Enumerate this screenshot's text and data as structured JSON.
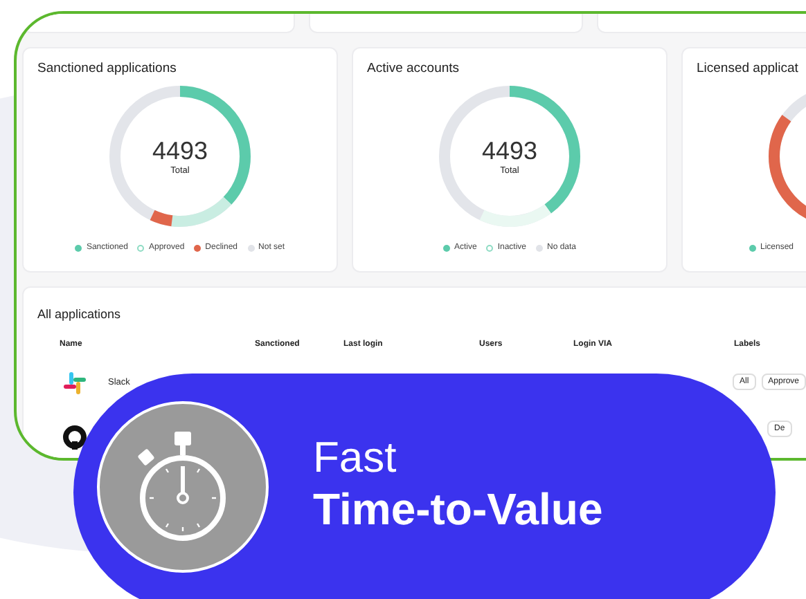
{
  "cards": [
    {
      "title": "Sanctioned applications",
      "total": "4493",
      "total_label": "Total",
      "legend": [
        {
          "label": "Sanctioned",
          "kind": "dot",
          "color": "#5ccbab"
        },
        {
          "label": "Approved",
          "kind": "ring",
          "color": "#8fdcc4"
        },
        {
          "label": "Declined",
          "kind": "dot",
          "color": "#e0664b"
        },
        {
          "label": "Not set",
          "kind": "dot",
          "color": "#e1e3e8"
        }
      ]
    },
    {
      "title": "Active accounts",
      "total": "4493",
      "total_label": "Total",
      "legend": [
        {
          "label": "Active",
          "kind": "dot",
          "color": "#5ccbab"
        },
        {
          "label": "Inactive",
          "kind": "ring",
          "color": "#8fdcc4"
        },
        {
          "label": "No data",
          "kind": "dot",
          "color": "#e1e3e8"
        }
      ]
    },
    {
      "title": "Licensed applicat",
      "legend": [
        {
          "label": "Licensed",
          "kind": "dot",
          "color": "#5ccbab"
        }
      ]
    }
  ],
  "table": {
    "title": "All applications",
    "columns": [
      "Name",
      "Sanctioned",
      "Last login",
      "Users",
      "Login VIA",
      "Labels"
    ],
    "rows": [
      {
        "name": "Slack",
        "labels": [
          "All",
          "Approve"
        ]
      },
      {
        "labels": [
          "De"
        ]
      }
    ]
  },
  "badge": {
    "line1": "Fast",
    "line2": "Time-to-Value"
  }
}
